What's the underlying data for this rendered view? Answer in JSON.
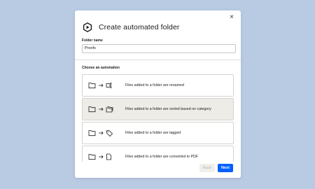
{
  "modal": {
    "title": "Create automated folder",
    "close_label": "×",
    "folder_name_label": "Folder name",
    "folder_name_value": "Proofs",
    "automation_label": "Choose an automation",
    "automations": [
      {
        "text": "Files added to a folder are renamed",
        "icon": "rename-icon",
        "selected": false
      },
      {
        "text": "Files added to a folder are sorted based on category",
        "icon": "sort-folders-icon",
        "selected": true
      },
      {
        "text": "Files added to a folder are tagged",
        "icon": "tag-icon",
        "selected": false
      },
      {
        "text": "Files added to a folder are converted to PDF",
        "icon": "convert-icon",
        "selected": false
      }
    ],
    "back_label": "Back",
    "next_label": "Next"
  },
  "colors": {
    "background": "#b9cbe3",
    "primary_button": "#0061fe",
    "selected_card": "#eeece7"
  }
}
